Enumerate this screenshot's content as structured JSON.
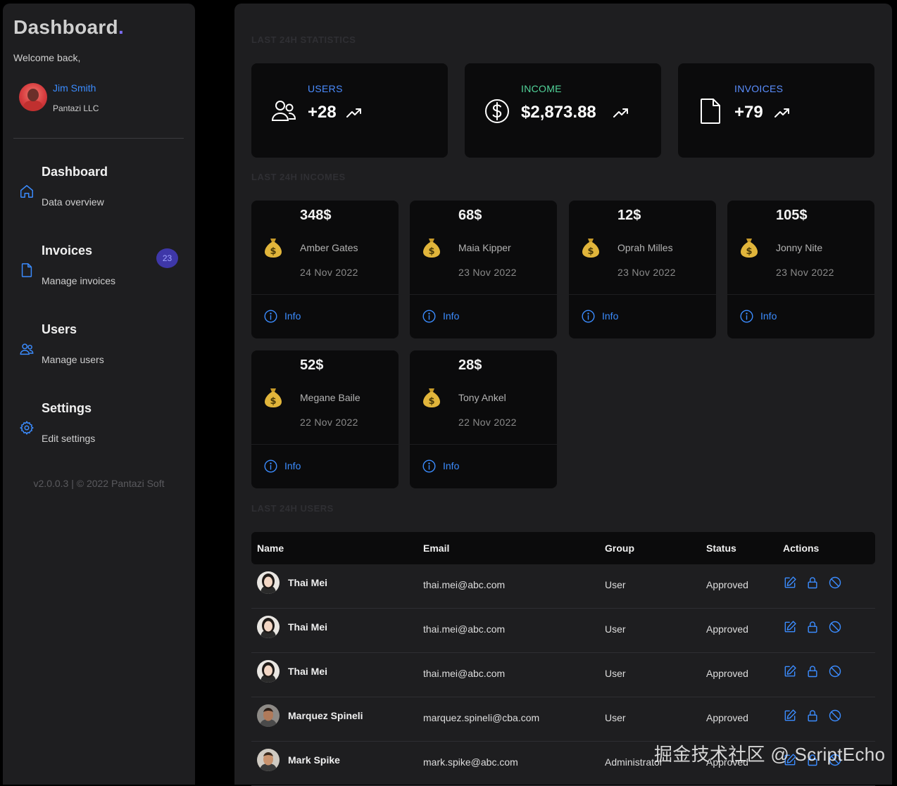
{
  "sidebar": {
    "brand": "Dashboard",
    "brand_dot": ".",
    "welcome": "Welcome back,",
    "user": {
      "name": "Jim Smith",
      "company": "Pantazi LLC"
    },
    "nav": [
      {
        "title": "Dashboard",
        "subtitle": "Data overview",
        "icon": "home-icon"
      },
      {
        "title": "Invoices",
        "subtitle": "Manage invoices",
        "icon": "file-icon",
        "badge": "23"
      },
      {
        "title": "Users",
        "subtitle": "Manage users",
        "icon": "users-icon"
      },
      {
        "title": "Settings",
        "subtitle": "Edit settings",
        "icon": "gear-icon"
      }
    ],
    "footer": "v2.0.0.3 | © 2022 Pantazi Soft"
  },
  "sections": {
    "stats": "LAST 24H STATISTICS",
    "incomes": "LAST 24H INCOMES",
    "users": "LAST 24H USERS"
  },
  "stats": [
    {
      "label": "USERS",
      "value": "+28",
      "icon": "users-icon",
      "label_color": "#4a8cff"
    },
    {
      "label": "INCOME",
      "value": "$2,873.88",
      "icon": "dollar-circle-icon",
      "label_color": "#52d49a"
    },
    {
      "label": "INVOICES",
      "value": "+79",
      "icon": "file-icon",
      "label_color": "#5b8fff"
    }
  ],
  "incomes": [
    {
      "amount": "348$",
      "name": "Amber Gates",
      "date": "24 Nov 2022",
      "info": "Info"
    },
    {
      "amount": "68$",
      "name": "Maia Kipper",
      "date": "23 Nov 2022",
      "info": "Info"
    },
    {
      "amount": "12$",
      "name": "Oprah Milles",
      "date": "23 Nov 2022",
      "info": "Info"
    },
    {
      "amount": "105$",
      "name": "Jonny Nite",
      "date": "23 Nov 2022",
      "info": "Info"
    },
    {
      "amount": "52$",
      "name": "Megane Baile",
      "date": "22 Nov 2022",
      "info": "Info"
    },
    {
      "amount": "28$",
      "name": "Tony Ankel",
      "date": "22 Nov 2022",
      "info": "Info"
    }
  ],
  "table": {
    "headers": [
      "Name",
      "Email",
      "Group",
      "Status",
      "Actions"
    ],
    "rows": [
      {
        "name": "Thai Mei",
        "email": "thai.mei@abc.com",
        "group": "User",
        "status": "Approved",
        "avatar": "female"
      },
      {
        "name": "Thai Mei",
        "email": "thai.mei@abc.com",
        "group": "User",
        "status": "Approved",
        "avatar": "female"
      },
      {
        "name": "Thai Mei",
        "email": "thai.mei@abc.com",
        "group": "User",
        "status": "Approved",
        "avatar": "female"
      },
      {
        "name": "Marquez Spineli",
        "email": "marquez.spineli@cba.com",
        "group": "User",
        "status": "Approved",
        "avatar": "male"
      },
      {
        "name": "Mark Spike",
        "email": "mark.spike@abc.com",
        "group": "Administrator",
        "status": "Approved",
        "avatar": "male2"
      }
    ]
  },
  "watermark": "掘金技术社区 @ ScriptEcho",
  "colors": {
    "accent": "#3b8cff",
    "brand_dot": "#7b6cf0",
    "income_green": "#52d49a"
  }
}
